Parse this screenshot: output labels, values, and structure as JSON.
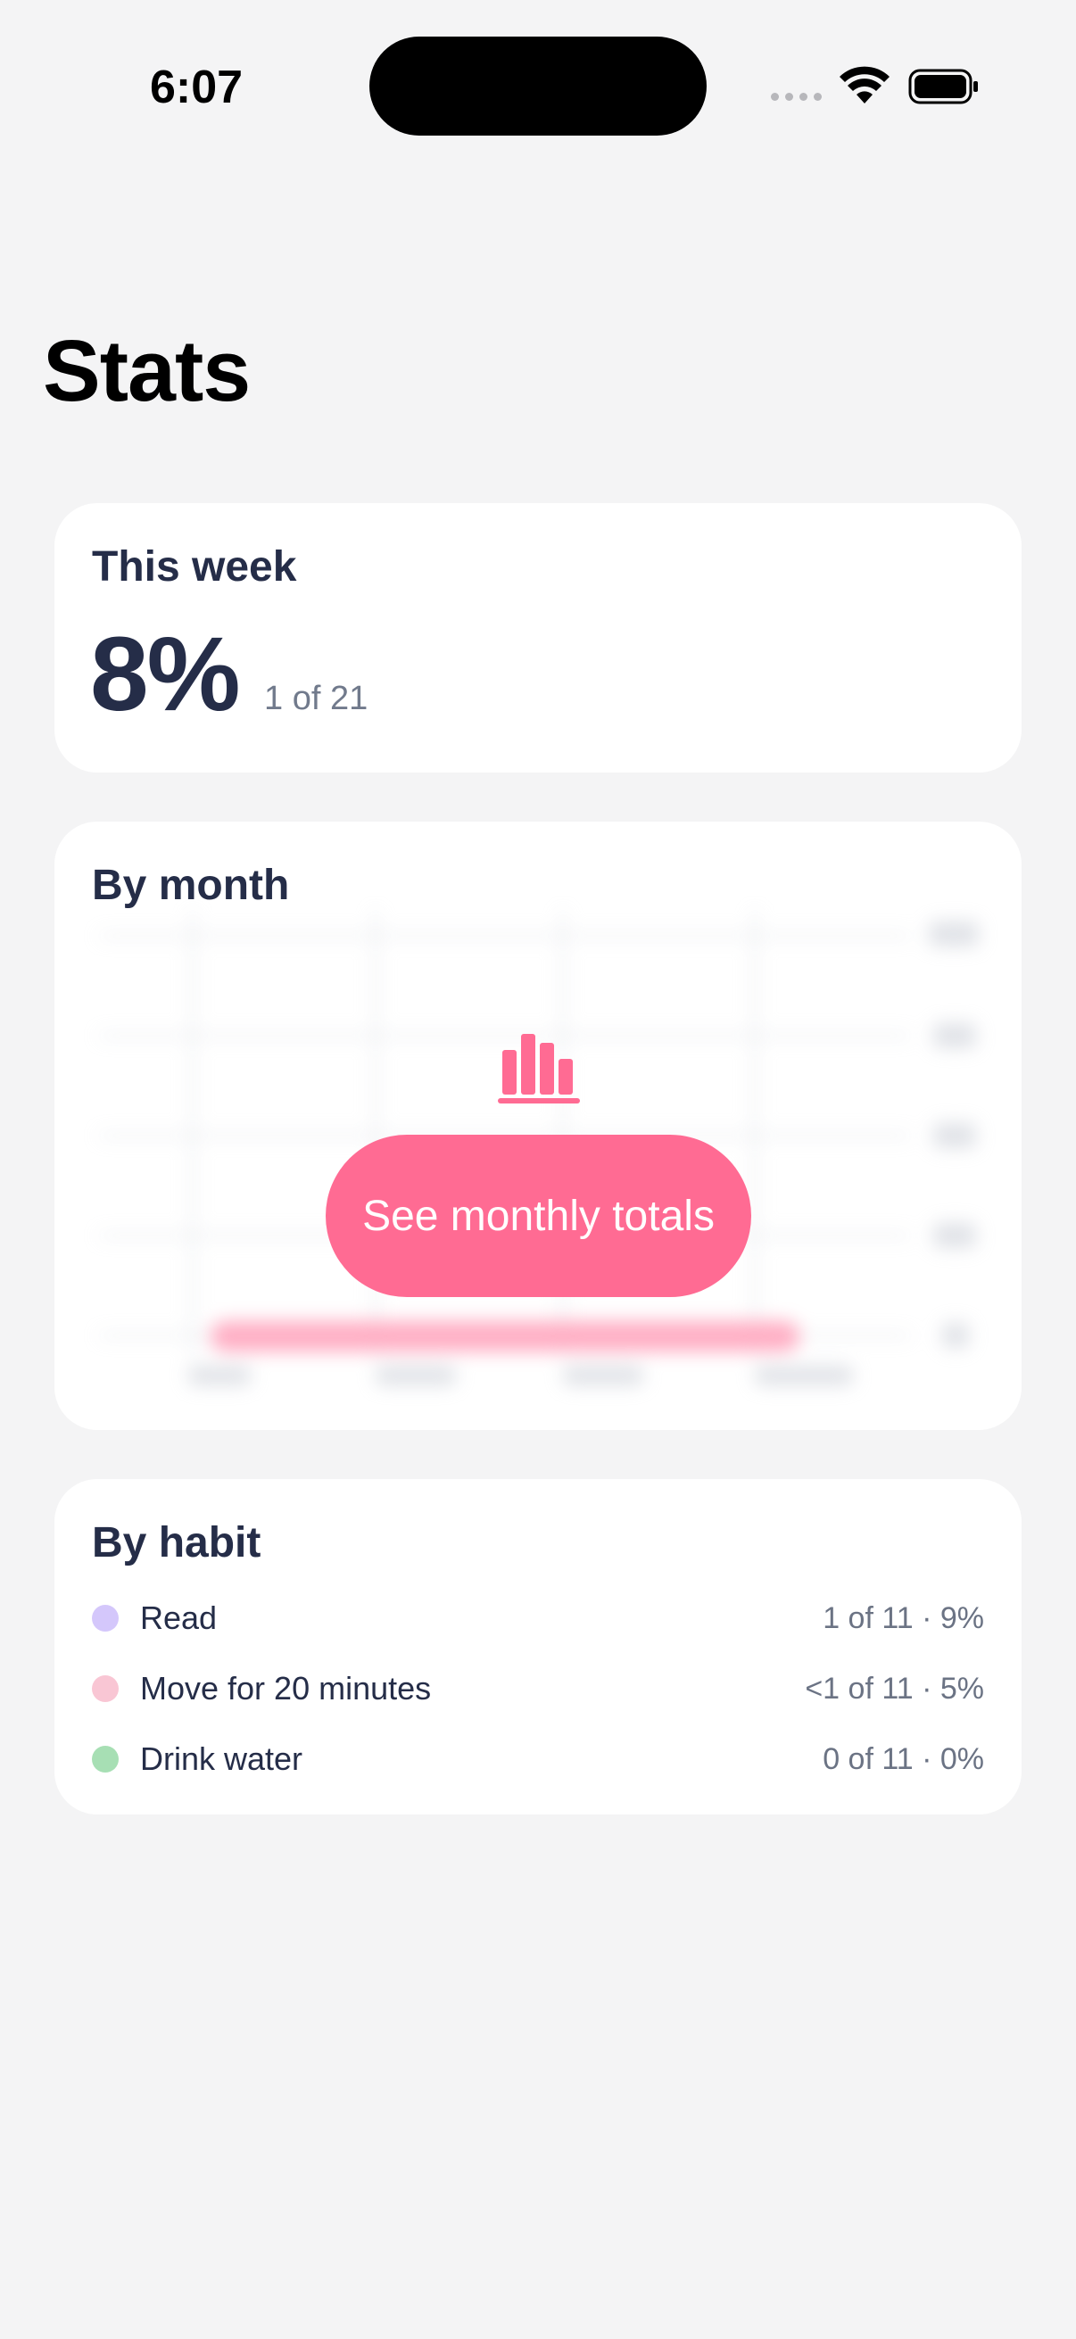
{
  "status_bar": {
    "time": "6:07"
  },
  "page": {
    "title": "Stats"
  },
  "this_week": {
    "title": "This week",
    "percent": "8%",
    "detail": "1 of 21"
  },
  "by_month": {
    "title": "By month",
    "button_label": "See monthly totals",
    "icon": "bar-chart-icon",
    "accent": "#ff6b93"
  },
  "by_habit": {
    "title": "By habit",
    "items": [
      {
        "name": "Read",
        "stat": "1 of 11 · 9%",
        "color": "#d4c7fb"
      },
      {
        "name": "Move for 20 minutes",
        "stat": "<1 of 11 · 5%",
        "color": "#f9c6d4"
      },
      {
        "name": "Drink water",
        "stat": "0 of 11 · 0%",
        "color": "#a7dfb4"
      }
    ]
  }
}
